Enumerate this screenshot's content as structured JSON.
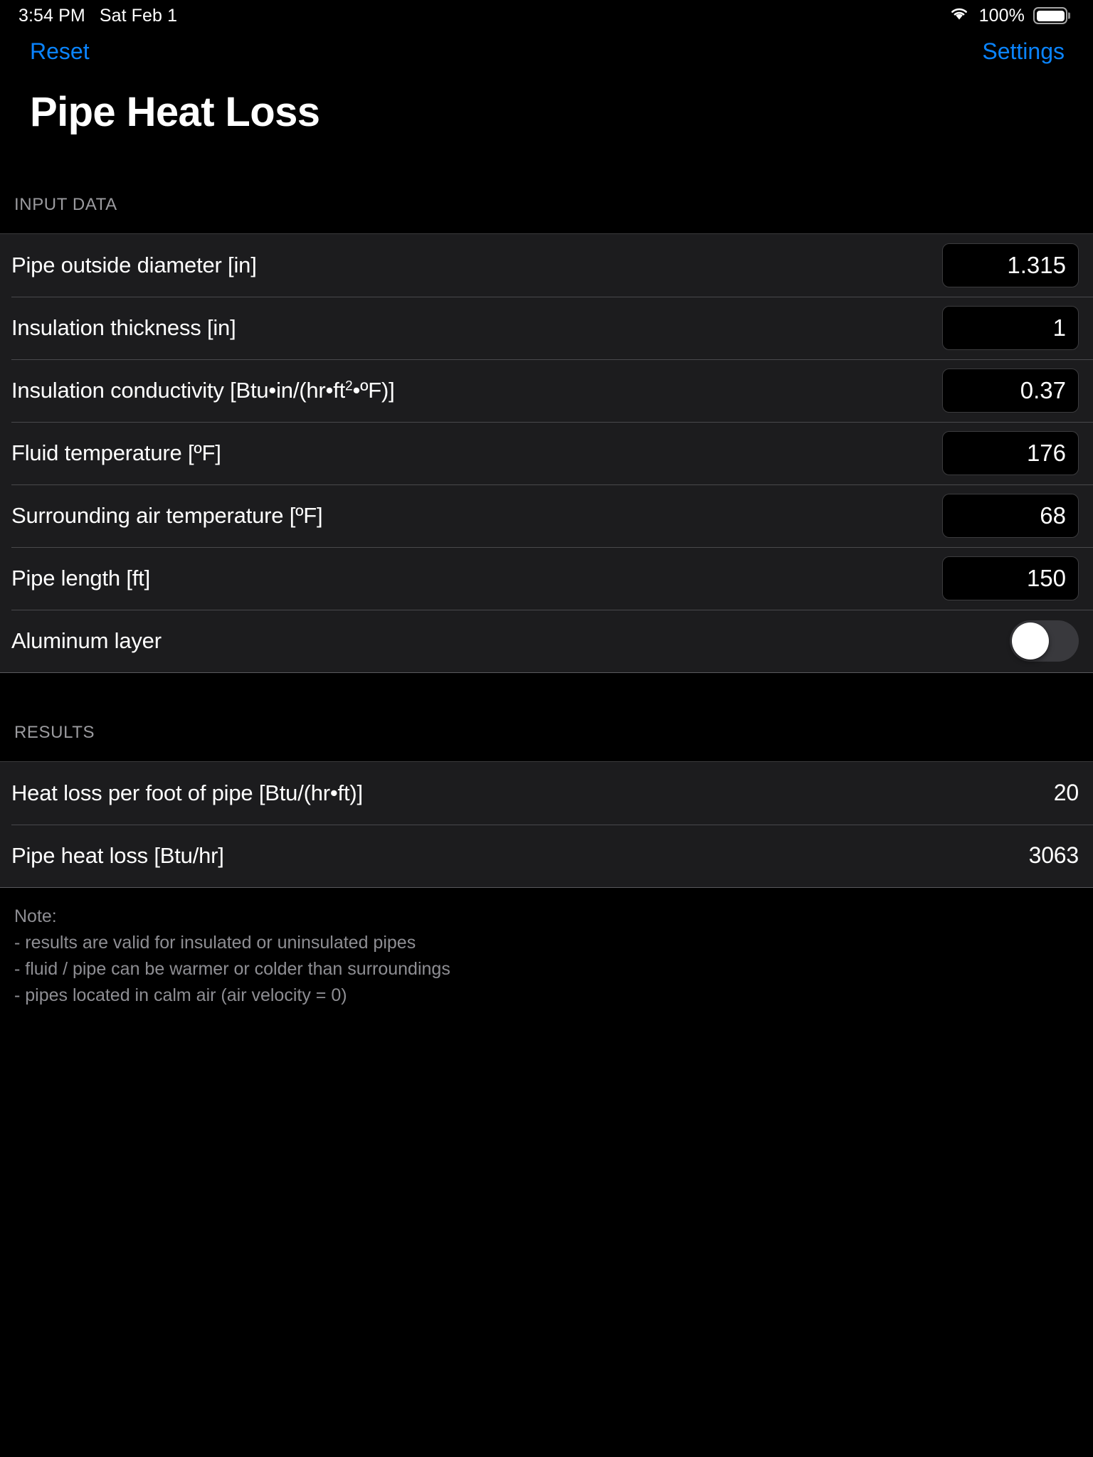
{
  "status_bar": {
    "time": "3:54 PM",
    "date": "Sat Feb 1",
    "wifi_icon": "wifi-icon",
    "battery_percent": "100%",
    "battery_icon": "battery-full-icon"
  },
  "nav": {
    "reset_label": "Reset",
    "settings_label": "Settings",
    "accent_color": "#0a84ff"
  },
  "header": {
    "title": "Pipe Heat Loss"
  },
  "input_section": {
    "header": "INPUT DATA",
    "rows": [
      {
        "label": "Pipe outside diameter [in]",
        "value": "1.315",
        "type": "field"
      },
      {
        "label": "Insulation thickness [in]",
        "value": "1",
        "type": "field"
      },
      {
        "label_html": "Insulation conductivity [Btu•in/(hr•ft<sup>2</sup>•ºF)]",
        "label": "Insulation conductivity [Btu•in/(hr•ft²•ºF)]",
        "value": "0.37",
        "type": "field"
      },
      {
        "label": "Fluid temperature [ºF]",
        "value": "176",
        "type": "field"
      },
      {
        "label": "Surrounding air temperature [ºF]",
        "value": "68",
        "type": "field"
      },
      {
        "label": "Pipe length [ft]",
        "value": "150",
        "type": "field"
      },
      {
        "label": "Aluminum layer",
        "value": "off",
        "type": "toggle"
      }
    ]
  },
  "results_section": {
    "header": "RESULTS",
    "rows": [
      {
        "label": "Heat loss per foot of pipe [Btu/(hr•ft)]",
        "value": "20"
      },
      {
        "label": "Pipe heat loss [Btu/hr]",
        "value": "3063"
      }
    ]
  },
  "note": {
    "text": "Note:\n- results are valid for insulated or uninsulated pipes\n- fluid / pipe can be warmer or colder than surroundings\n- pipes located in calm air (air velocity = 0)"
  }
}
